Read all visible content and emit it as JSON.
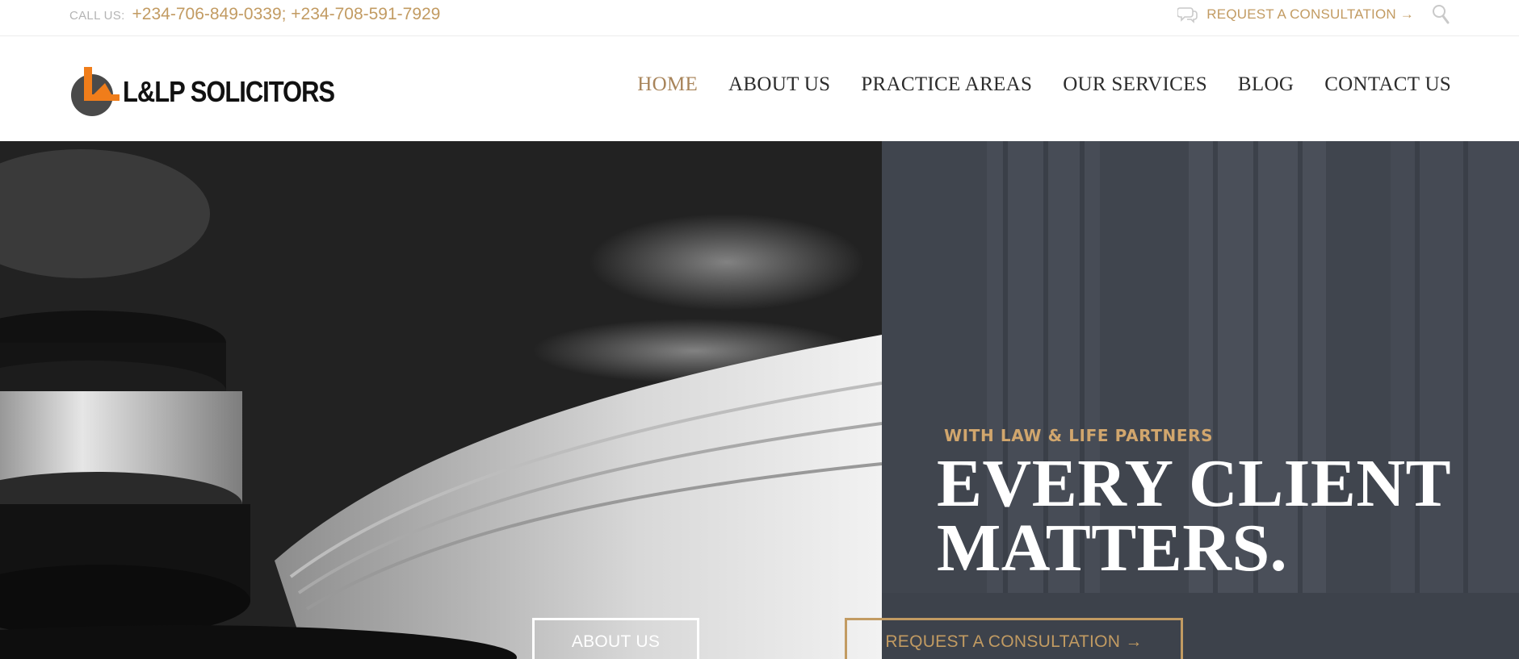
{
  "topbar": {
    "call_label": "CALL US:",
    "phone_numbers": "+234-706-849-0339; +234-708-591-7929",
    "consult_link": "REQUEST A CONSULTATION →",
    "chat_icon": "chat-bubbles-icon",
    "search_icon": "search-icon"
  },
  "brand": {
    "name": "L&LP SOLICITORS",
    "accent_color": "#c29b62",
    "logo_orange": "#f07d1a"
  },
  "nav": {
    "items": [
      {
        "label": "HOME",
        "active": true
      },
      {
        "label": "ABOUT US",
        "active": false
      },
      {
        "label": "PRACTICE AREAS",
        "active": false
      },
      {
        "label": "OUR SERVICES",
        "active": false
      },
      {
        "label": "BLOG",
        "active": false
      },
      {
        "label": "CONTACT US",
        "active": false
      }
    ]
  },
  "hero": {
    "tagline": "WITH LAW & LIFE PARTNERS",
    "headline_line1": "EVERY CLIENT",
    "headline_line2": "MATTERS.",
    "about_button": "ABOUT US",
    "consult_button": "REQUEST A CONSULTATION →"
  }
}
